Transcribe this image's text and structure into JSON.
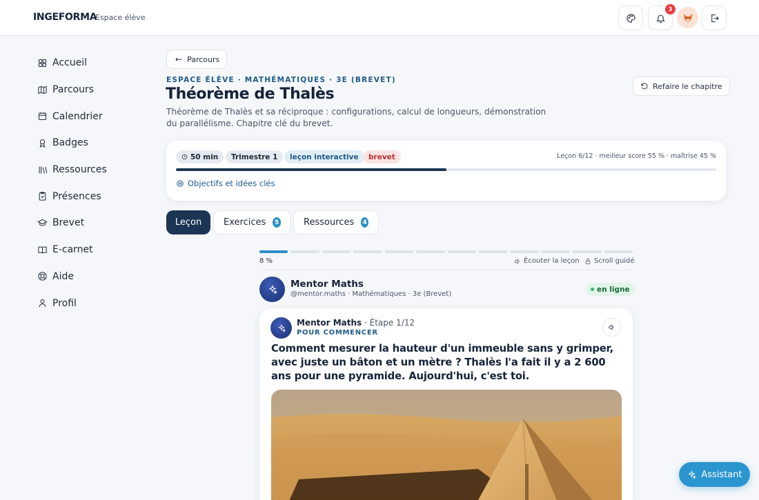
{
  "header": {
    "brand": "INGEFORMA",
    "brand_sub": "Espace élève",
    "notification_count": "3",
    "icons": [
      "palette-icon",
      "bell-icon",
      "avatar",
      "logout-icon"
    ]
  },
  "sidebar": {
    "items": [
      {
        "label": "Accueil",
        "icon": "home-grid-icon"
      },
      {
        "label": "Parcours",
        "icon": "map-icon"
      },
      {
        "label": "Calendrier",
        "icon": "calendar-icon"
      },
      {
        "label": "Badges",
        "icon": "award-icon"
      },
      {
        "label": "Ressources",
        "icon": "library-icon"
      },
      {
        "label": "Présences",
        "icon": "clipboard-check-icon"
      },
      {
        "label": "Brevet",
        "icon": "graduation-cap-icon"
      },
      {
        "label": "E-carnet",
        "icon": "book-open-icon"
      },
      {
        "label": "Aide",
        "icon": "lifebuoy-icon"
      },
      {
        "label": "Profil",
        "icon": "user-icon"
      }
    ]
  },
  "main": {
    "back_label": "Parcours",
    "overline": "ESPACE ÉLÈVE · MATHÉMATIQUES · 3E (BREVET)",
    "title": "Théorème de Thalès",
    "description": "Théorème de Thalès et sa réciproque : configurations, calcul de longueurs, démonstration du parallélisme. Chapitre clé du brevet.",
    "redo_label": "Refaire le chapitre",
    "card": {
      "chips": [
        "50 min",
        "Trimestre 1",
        "leçon interactive",
        "brevet"
      ],
      "stats": "Leçon 6/12 · meilleur score 55 % · maîtrise 45 %",
      "progress_fraction": 0.5,
      "objectives_label": "Objectifs et idées clés"
    },
    "tabs": [
      {
        "label": "Leçon",
        "count": null
      },
      {
        "label": "Exercices",
        "count": "5"
      },
      {
        "label": "Ressources",
        "count": "4"
      }
    ]
  },
  "lesson": {
    "segments_total": 12,
    "segments_done": 1,
    "percent_label": "8 %",
    "listen_label": "Écouter la leçon",
    "scroll_label": "Scroll guidé",
    "mentor_name": "Mentor Maths",
    "mentor_meta": "@mentor.maths · Mathématiques · 3e (Brevet)",
    "online_label": "en ligne",
    "step_author": "Mentor Maths",
    "step_label": "· Étape 1/12",
    "step_kicker": "POUR COMMENCER",
    "question": "Comment mesurer la hauteur d'un immeuble sans y grimper, avec juste un bâton et un mètre ? Thalès l'a fait il y a 2 600 ans pour une pyramide. Aujourd'hui, c'est toi."
  },
  "assistant_label": "Assistant",
  "colors": {
    "primary_dark": "#1c3554",
    "accent_blue": "#2b8fc4",
    "brevet_chip": "#fbe3e3",
    "online_green": "#2fb56a"
  }
}
